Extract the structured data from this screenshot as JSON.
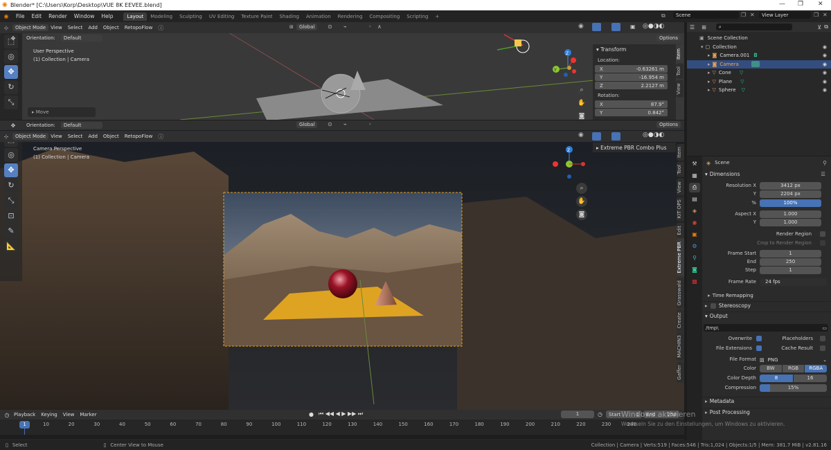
{
  "window": {
    "title": "Blender* [C:\\Users\\Korp\\Desktop\\VUE 8K EEVEE.blend]",
    "controls": [
      "—",
      "❐",
      "✕"
    ]
  },
  "menu": [
    "File",
    "Edit",
    "Render",
    "Window",
    "Help"
  ],
  "workspaces": [
    "Layout",
    "Modeling",
    "Sculpting",
    "UV Editing",
    "Texture Paint",
    "Shading",
    "Animation",
    "Rendering",
    "Compositing",
    "Scripting"
  ],
  "scene_name": "Scene",
  "view_layer": "View Layer",
  "header": {
    "mode": "Object Mode",
    "view": "View",
    "select": "Select",
    "add": "Add",
    "object": "Object",
    "retopoflow": "RetopoFlow",
    "orientation_label": "Orientation:",
    "orientation": "Default",
    "transform": "Global",
    "options": "Options"
  },
  "top_viewport": {
    "perspective": "User Perspective",
    "collection": "(1) Collection | Camera",
    "last_op": "Move"
  },
  "bottom_viewport": {
    "perspective": "Camera Perspective",
    "collection": "(1) Collection | Camera"
  },
  "n_panel": {
    "title": "Transform",
    "location_label": "Location:",
    "rotation_label": "Rotation:",
    "loc": [
      {
        "axis": "X",
        "value": "-0.63261 m"
      },
      {
        "axis": "Y",
        "value": "-16.954 m"
      },
      {
        "axis": "Z",
        "value": "2.2127 m"
      }
    ],
    "rot": [
      {
        "axis": "X",
        "value": "87.9°"
      },
      {
        "axis": "Y",
        "value": "0.842°"
      }
    ],
    "tabs_top": [
      "Item",
      "Tool",
      "View"
    ]
  },
  "n_panel2": {
    "title": "Extreme PBR Combo Plus",
    "tabs": [
      "Item",
      "Tool",
      "View",
      "KIT OPS",
      "Edit",
      "Extreme PBR",
      "Grasswald",
      "Create",
      "MACHIN3",
      "Gaffer"
    ]
  },
  "outliner": {
    "root": "Scene Collection",
    "collection": "Collection",
    "items": [
      {
        "name": "Camera.001",
        "selected": false
      },
      {
        "name": "Camera",
        "selected": true
      },
      {
        "name": "Cone",
        "selected": false
      },
      {
        "name": "Plane",
        "selected": false
      },
      {
        "name": "Sphere",
        "selected": false
      }
    ]
  },
  "properties": {
    "scene": "Scene",
    "dimensions": "Dimensions",
    "resolution_x_label": "Resolution X",
    "resolution_x": "3412 px",
    "y_label": "Y",
    "resolution_y": "2204 px",
    "percent_label": "%",
    "percent": "100%",
    "aspect_x_label": "Aspect X",
    "aspect_x": "1.000",
    "aspect_y": "1.000",
    "render_region": "Render Region",
    "crop_region": "Crop to Render Region",
    "frame_start_label": "Frame Start",
    "frame_start": "1",
    "end_label": "End",
    "frame_end": "250",
    "step_label": "Step",
    "step": "1",
    "frame_rate_label": "Frame Rate",
    "frame_rate": "24 fps",
    "time_remapping": "Time Remapping",
    "stereoscopy": "Stereoscopy",
    "output": "Output",
    "output_path": "/tmp\\",
    "overwrite": "Overwrite",
    "placeholders": "Placeholders",
    "file_extensions": "File Extensions",
    "cache_result": "Cache Result",
    "file_format_label": "File Format",
    "file_format": "PNG",
    "color_label": "Color",
    "color_opts": [
      "BW",
      "RGB",
      "RGBA"
    ],
    "color_depth_label": "Color Depth",
    "depth_opts": [
      "8",
      "16"
    ],
    "compression_label": "Compression",
    "compression": "15%",
    "metadata": "Metadata",
    "post_processing": "Post Processing"
  },
  "timeline": {
    "menus": [
      "Playback",
      "Keying",
      "View",
      "Marker"
    ],
    "current_frame": "1",
    "start_label": "Start",
    "start": "1",
    "end_label": "End",
    "end": "250",
    "ticks": [
      "1",
      "10",
      "20",
      "30",
      "40",
      "50",
      "60",
      "70",
      "80",
      "90",
      "100",
      "110",
      "120",
      "130",
      "140",
      "150",
      "160",
      "170",
      "180",
      "190",
      "200",
      "210",
      "220",
      "230",
      "240"
    ]
  },
  "status": {
    "select": "Select",
    "center": "Center View to Mouse",
    "stats": "Collection | Camera | Verts:519 | Faces:546 | Tris:1,024 | Objects:1/5 | Mem: 381.7 MiB | v2.81.16"
  },
  "watermark": {
    "line1": "Windows aktivieren",
    "line2": "Wechseln Sie zu den Einstellungen, um Windows zu aktivieren."
  },
  "colors": {
    "accent": "#4772b3",
    "selected_row": "#334d80",
    "camera_frame": "#e8a21a",
    "plane": "#e0a020"
  }
}
